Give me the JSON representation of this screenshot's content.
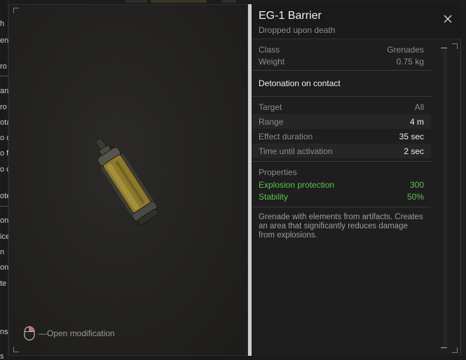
{
  "background_fragments": [
    "h",
    "en",
    "ro",
    "an",
    "ro",
    "ota",
    "o c",
    "o f",
    "o c",
    "ote",
    "on",
    "ice",
    "n",
    "on",
    "te",
    "ns",
    "s"
  ],
  "preview": {
    "item_icon": "grenade-illustration",
    "hint": {
      "icon": "mouse-right-click-icon",
      "label": "—Open modification"
    }
  },
  "header": {
    "title": "EG-1 Barrier",
    "subtitle": "Dropped upon death",
    "close_icon": "close-icon"
  },
  "basic": [
    {
      "key": "Class",
      "value": "Grenades"
    },
    {
      "key": "Weight",
      "value": "0.75 kg"
    }
  ],
  "detonation": "Detonation on contact",
  "stats": [
    {
      "key": "Target",
      "value": "All"
    },
    {
      "key": "Range",
      "value": "4 m"
    },
    {
      "key": "Effect duration",
      "value": "35 sec"
    },
    {
      "key": "Time until activation",
      "value": "2 sec"
    }
  ],
  "properties": {
    "label": "Properties",
    "items": [
      {
        "key": "Explosion protection",
        "value": "300"
      },
      {
        "key": "Stability",
        "value": "50%"
      }
    ]
  },
  "description": "Grenade with elements from artifacts. Creates an area that significantly reduces damage from explosions.",
  "colors": {
    "positive": "#58c24a",
    "divider_accent": "#cfcfcf",
    "panel_bg": "#1e1e1e"
  }
}
